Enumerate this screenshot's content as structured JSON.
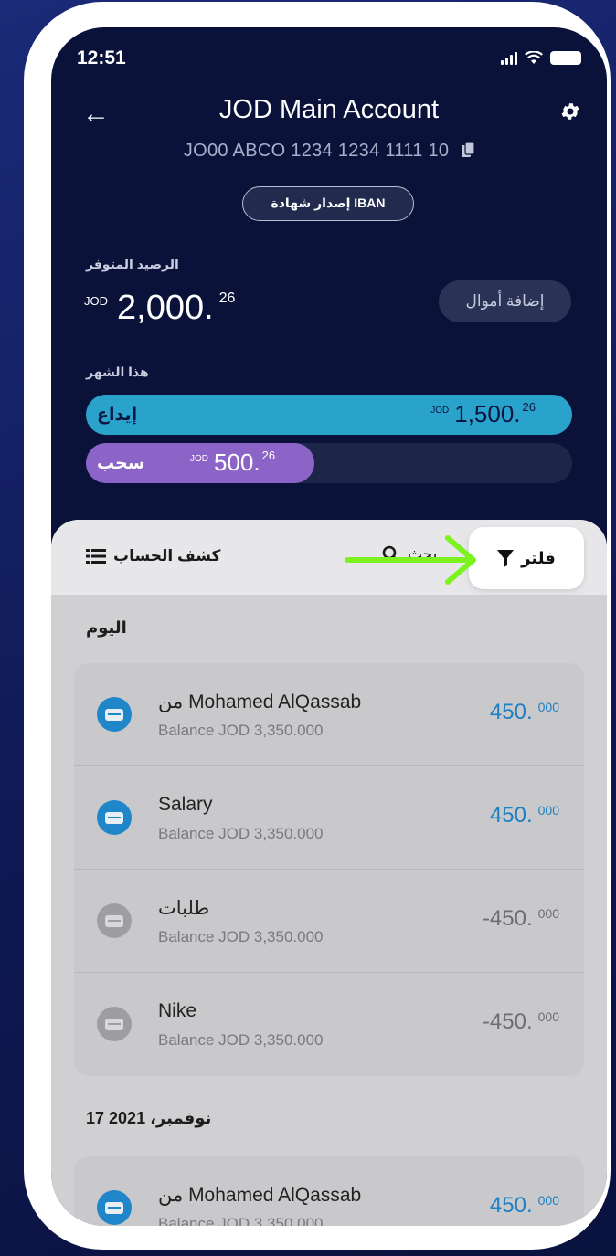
{
  "status_bar": {
    "time": "12:51"
  },
  "header": {
    "title": "JOD Main Account",
    "iban": "JO00 ABCO 1234 1234 1111 10",
    "iban_button": "إصدار شهادة IBAN"
  },
  "balance": {
    "label": "الرصيد المتوفر",
    "currency": "JOD",
    "amount_main": "2,000.",
    "amount_decimal": "26",
    "add_funds": "إضافة أموال"
  },
  "this_month": {
    "label": "هذا الشهر",
    "deposit": {
      "label": "إيداع",
      "currency": "JOD",
      "amount_main": "1,500.",
      "amount_decimal": "26",
      "fill_fraction": 1.0
    },
    "withdraw": {
      "label": "سحب",
      "currency": "JOD",
      "amount_main": "500.",
      "amount_decimal": "26",
      "fill_fraction": 0.47
    }
  },
  "toolbar": {
    "statement": "كشف الحساب",
    "search": "بحث",
    "filter": "فلتر"
  },
  "sections": [
    {
      "heading": "اليوم",
      "transactions": [
        {
          "title": "من Mohamed AlQassab",
          "balance": "Balance JOD 3,350.000",
          "amount_main": "450.",
          "amount_decimal": "000",
          "type": "credit"
        },
        {
          "title": "Salary",
          "balance": "Balance JOD 3,350.000",
          "amount_main": "450.",
          "amount_decimal": "000",
          "type": "credit"
        },
        {
          "title": "طلبات",
          "balance": "Balance JOD 3,350.000",
          "amount_main": "-450.",
          "amount_decimal": "000",
          "type": "debit"
        },
        {
          "title": "Nike",
          "balance": "Balance JOD 3,350.000",
          "amount_main": "-450.",
          "amount_decimal": "000",
          "type": "debit"
        }
      ]
    },
    {
      "heading": "17 نوفمبر، 2021",
      "transactions": [
        {
          "title": "من Mohamed AlQassab",
          "balance": "Balance JOD 3,350.000",
          "amount_main": "450.",
          "amount_decimal": "000",
          "type": "credit"
        }
      ]
    }
  ],
  "colors": {
    "background": "#0f1a55",
    "screen": "#0a1239",
    "deposit_bar": "#29a3cb",
    "withdraw_bar": "#8c63c6",
    "credit_amount": "#1d7fc4",
    "annotation_arrow": "#7cf21f"
  },
  "icons": [
    "back-arrow-icon",
    "gear-icon",
    "copy-icon",
    "list-icon",
    "search-icon",
    "filter-funnel-icon",
    "card-icon"
  ]
}
